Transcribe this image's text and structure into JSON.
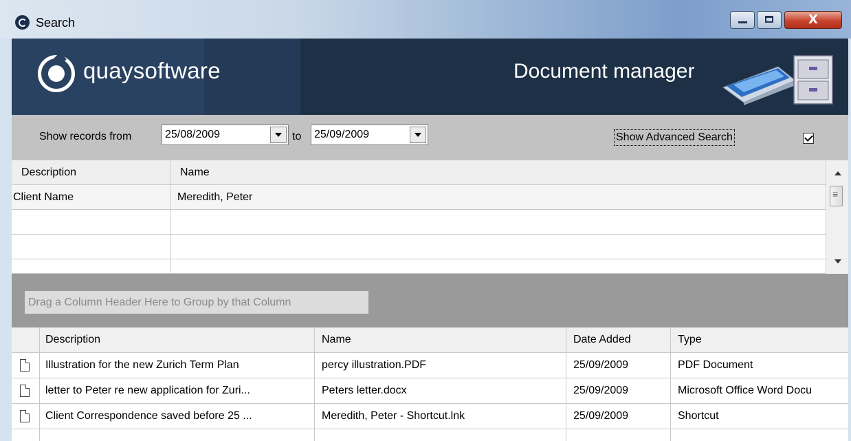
{
  "window": {
    "title": "Search",
    "controls": {
      "minimize": "minimize",
      "maximize": "maximize",
      "close": "X"
    }
  },
  "banner": {
    "logo_text": "quaysoftware",
    "title": "Document manager"
  },
  "filter": {
    "from_label": "Show records from",
    "from_value": "25/08/2009",
    "to_label": "to",
    "to_value": "25/09/2009",
    "advanced_label": "Show Advanced Search",
    "advanced_checked": true
  },
  "criteria": {
    "headers": {
      "description": "Description",
      "name": "Name"
    },
    "rows": [
      {
        "description": "Client Name",
        "name": "Meredith, Peter"
      },
      {
        "description": "",
        "name": ""
      },
      {
        "description": "",
        "name": ""
      },
      {
        "description": "",
        "name": ""
      }
    ]
  },
  "group_hint": "Drag a Column Header Here to Group by that Column",
  "results": {
    "headers": {
      "description": "Description",
      "name": "Name",
      "date_added": "Date Added",
      "type": "Type"
    },
    "rows": [
      {
        "icon": "document-icon",
        "description": "Illustration for the new Zurich Term Plan",
        "name": "percy illustration.PDF",
        "date_added": "25/09/2009",
        "type": "PDF Document"
      },
      {
        "icon": "document-icon",
        "description": "letter to Peter re new application for Zuri...",
        "name": "Peters letter.docx",
        "date_added": "25/09/2009",
        "type": "Microsoft Office Word Docu"
      },
      {
        "icon": "document-icon",
        "description": "Client Correspondence saved before 25 ...",
        "name": "Meredith, Peter - Shortcut.lnk",
        "date_added": "25/09/2009",
        "type": "Shortcut"
      }
    ]
  },
  "colors": {
    "banner_bg": "#1d3046",
    "filter_bg": "#c2c2c2",
    "group_bg": "#9a9a9a",
    "close_button": "#c8452e"
  }
}
